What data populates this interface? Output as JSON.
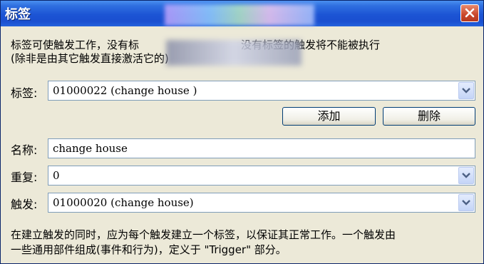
{
  "window": {
    "title": "标签"
  },
  "description": "标签可使触发工作，没有标                              没有标签的触发将不能被执行\n(除非是由其它触发直接激活它的)",
  "tag_field": {
    "label": "标签:",
    "value": "01000022 (change house )"
  },
  "buttons": {
    "add": "添加",
    "delete": "删除"
  },
  "name_field": {
    "label": "名称:",
    "value": "change house"
  },
  "repeat_field": {
    "label": "重复:",
    "value": "0"
  },
  "trigger_field": {
    "label": "触发:",
    "value": "01000020 (change house)"
  },
  "footer": "在建立触发的同时，应为每个触发建立一个标签，以保证其正常工作。一个触发由\n一些通用部件组成(事件和行为)，定义于 \"Trigger\" 部分。",
  "icons": [
    "close-icon",
    "chevron-down-icon"
  ],
  "colors": {
    "titlebar": "#1c54d4",
    "close": "#c9472b",
    "face": "#ece9d8",
    "border": "#7f9db9"
  }
}
